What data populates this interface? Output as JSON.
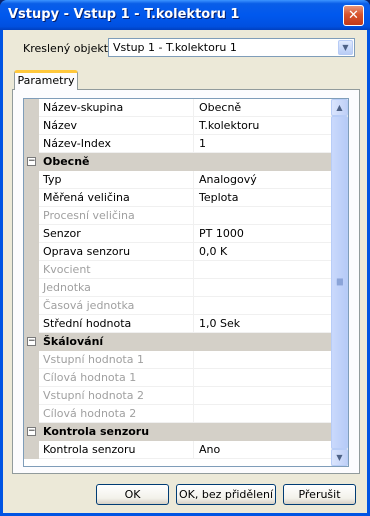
{
  "window": {
    "title": "Vstupy - Vstup 1 - T.kolektoru 1",
    "close_symbol": "✕"
  },
  "object_selector": {
    "label": "Kreslený objekt:",
    "value": "Vstup 1 - T.kolektoru 1"
  },
  "tabs": [
    {
      "label": "Parametry"
    }
  ],
  "property_grid": {
    "rows": [
      {
        "type": "prop",
        "name": "Název-skupina",
        "value": "Obecně",
        "enabled": true
      },
      {
        "type": "prop",
        "name": "Název",
        "value": "T.kolektoru",
        "enabled": true
      },
      {
        "type": "prop",
        "name": "Název-Index",
        "value": "1",
        "enabled": true
      },
      {
        "type": "category",
        "name": "Obecně",
        "expander": "−"
      },
      {
        "type": "prop",
        "name": "Typ",
        "value": "Analogový",
        "enabled": true
      },
      {
        "type": "prop",
        "name": "Měřená veličina",
        "value": "Teplota",
        "enabled": true
      },
      {
        "type": "prop",
        "name": "Procesní veličina",
        "value": "",
        "enabled": false
      },
      {
        "type": "prop",
        "name": "Senzor",
        "value": "PT 1000",
        "enabled": true
      },
      {
        "type": "prop",
        "name": "Oprava senzoru",
        "value": "0,0 K",
        "enabled": true
      },
      {
        "type": "prop",
        "name": "Kvocient",
        "value": "",
        "enabled": false
      },
      {
        "type": "prop",
        "name": "Jednotka",
        "value": "",
        "enabled": false
      },
      {
        "type": "prop",
        "name": "Časová jednotka",
        "value": "",
        "enabled": false
      },
      {
        "type": "prop",
        "name": "Střední hodnota",
        "value": "1,0 Sek",
        "enabled": true
      },
      {
        "type": "category",
        "name": "Škálování",
        "expander": "−"
      },
      {
        "type": "prop",
        "name": "Vstupní hodnota 1",
        "value": "",
        "enabled": false
      },
      {
        "type": "prop",
        "name": "Cílová hodnota 1",
        "value": "",
        "enabled": false
      },
      {
        "type": "prop",
        "name": "Vstupní hodnota 2",
        "value": "",
        "enabled": false
      },
      {
        "type": "prop",
        "name": "Cílová hodnota 2",
        "value": "",
        "enabled": false
      },
      {
        "type": "category",
        "name": "Kontrola senzoru",
        "expander": "−"
      },
      {
        "type": "prop",
        "name": "Kontrola senzoru",
        "value": "Ano",
        "enabled": true
      }
    ],
    "scrollbar": {
      "up_symbol": "▲",
      "down_symbol": "▼"
    }
  },
  "buttons": {
    "ok": "OK",
    "ok_no_assign": "OK, bez přidělení",
    "cancel": "Přerušit"
  },
  "colors": {
    "title_bar": "#0058ee",
    "dialog_face": "#ece9d8",
    "category_bg": "#d4d0c8",
    "disabled_text": "#a0a0a0"
  }
}
